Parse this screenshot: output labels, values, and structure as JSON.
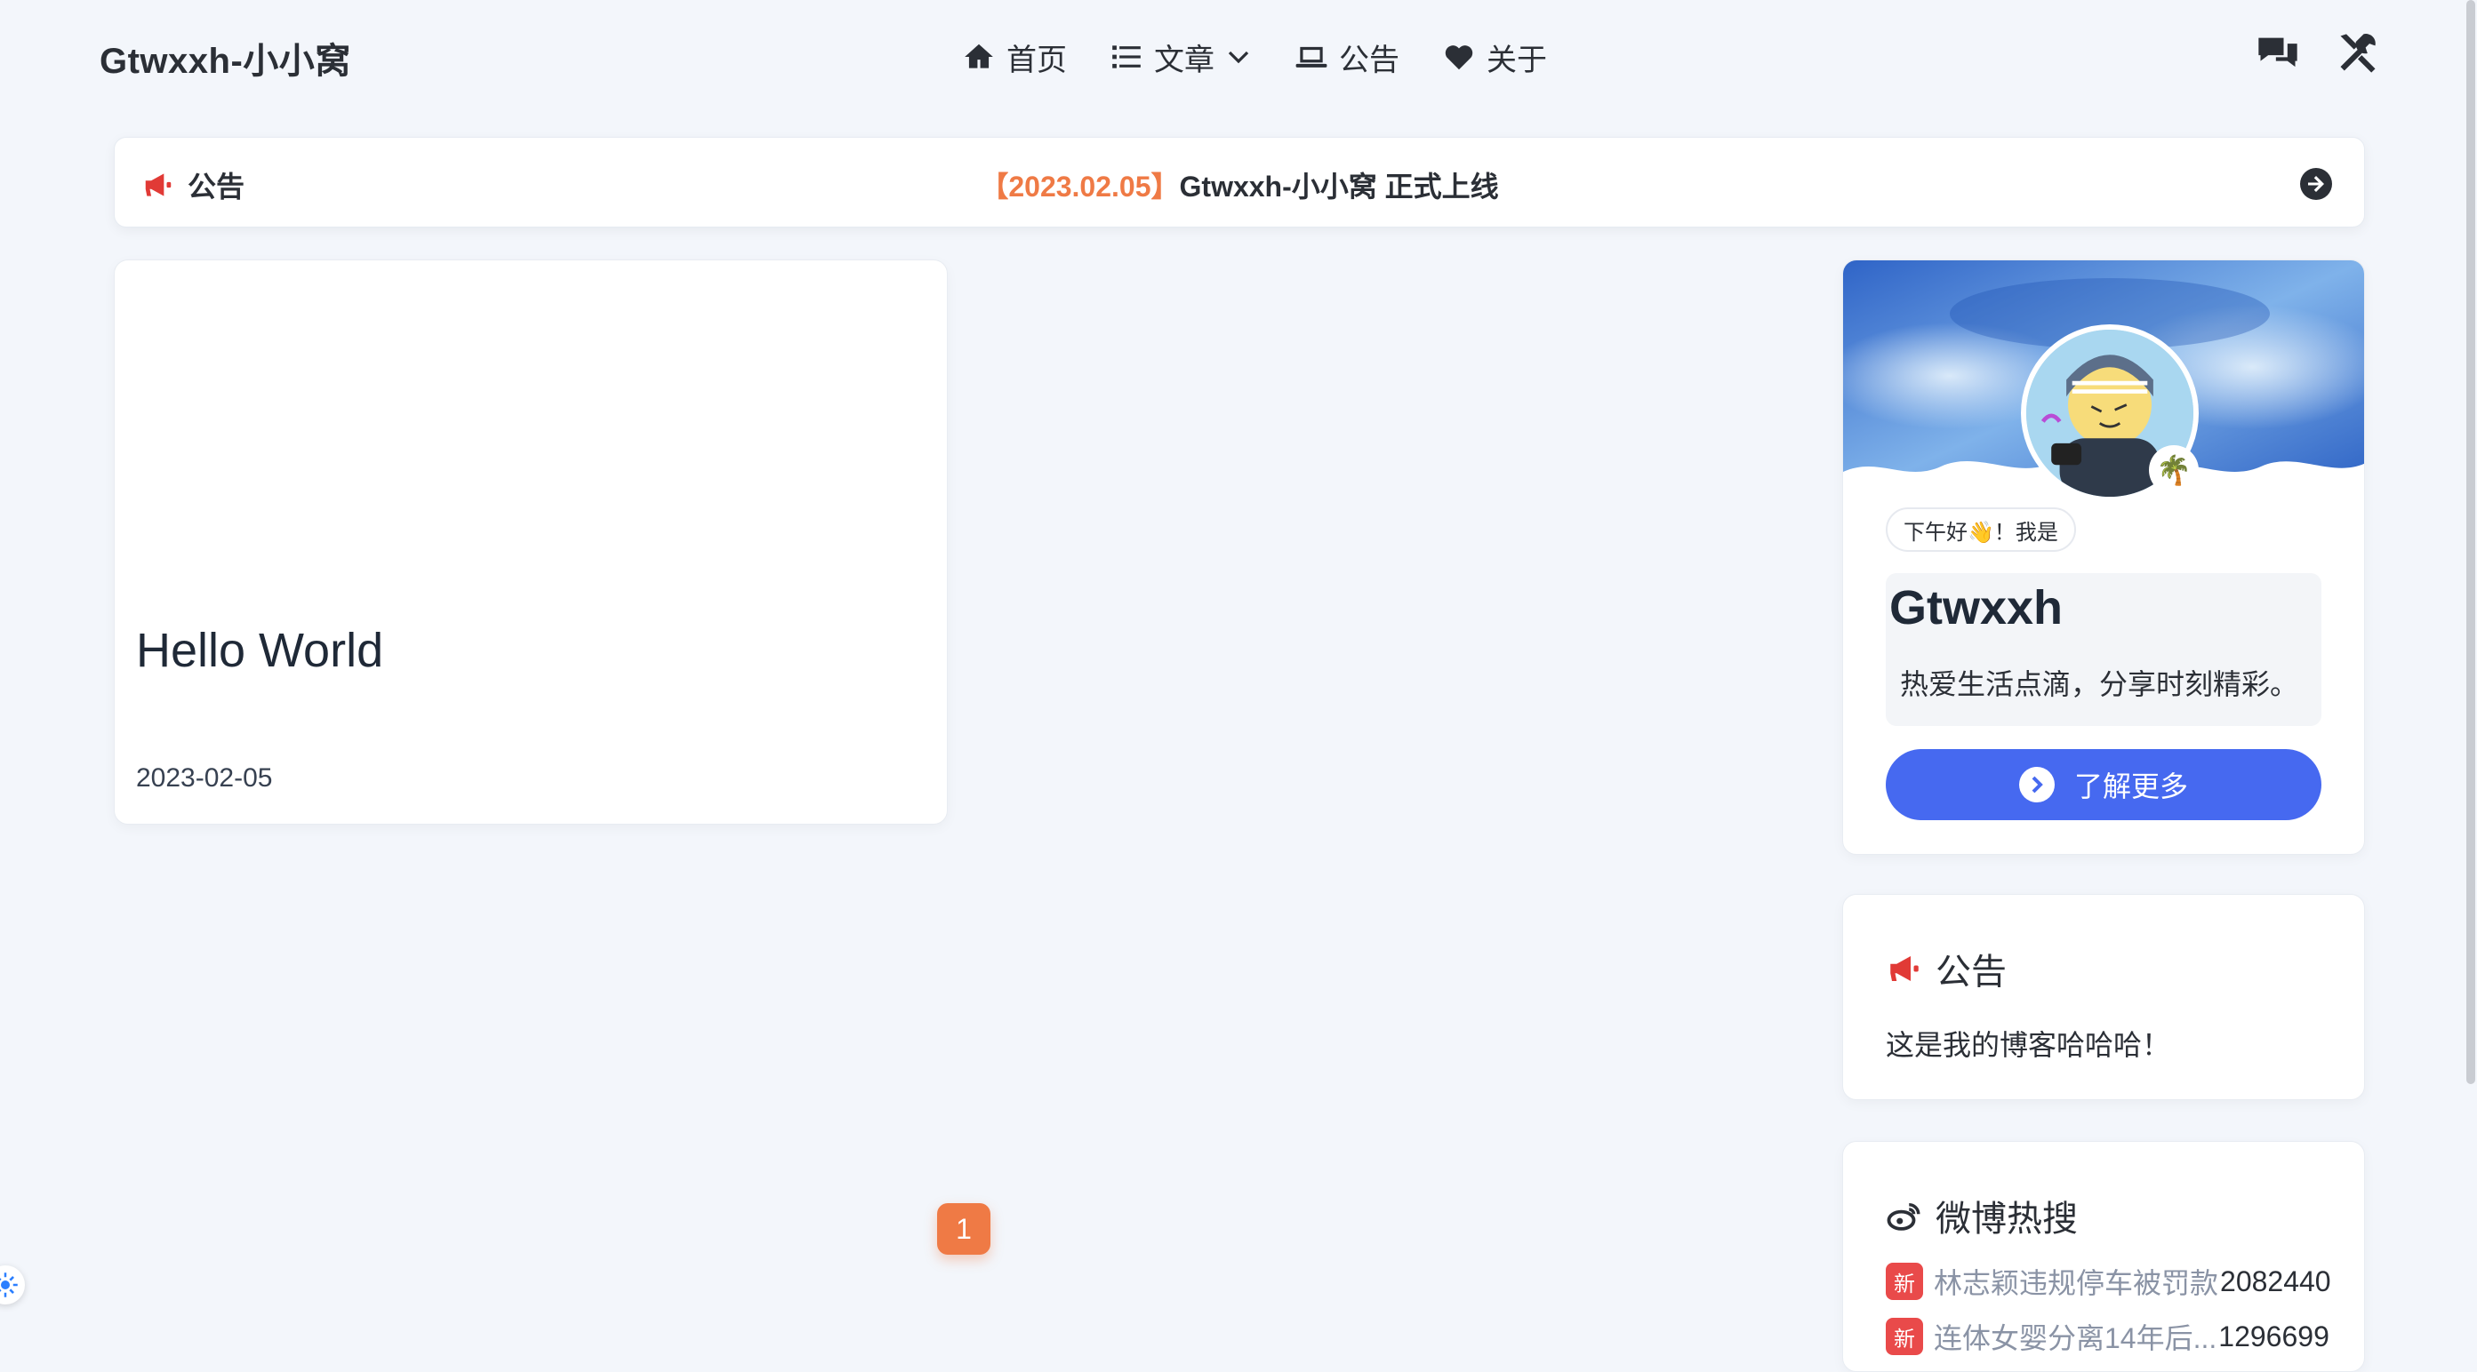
{
  "site": {
    "logo": "Gtwxxh-小小窝"
  },
  "nav": {
    "items": [
      {
        "label": "首页",
        "icon": "home-icon"
      },
      {
        "label": "文章",
        "icon": "list-icon"
      },
      {
        "label": "公告",
        "icon": "laptop-icon"
      },
      {
        "label": "关于",
        "icon": "heart-icon"
      }
    ],
    "right_icons": [
      "chat-icon",
      "tools-icon"
    ]
  },
  "announcement_bar": {
    "label": "公告",
    "date": "【2023.02.05】",
    "text": "Gtwxxh-小小窝 正式上线"
  },
  "post": {
    "title": "Hello World",
    "date": "2023-02-05"
  },
  "pagination": {
    "current": "1"
  },
  "profile": {
    "greeting": "下午好👋！我是",
    "name": "Gtwxxh",
    "bio": "热爱生活点滴，分享时刻精彩。",
    "button_label": "了解更多",
    "badge": "🌴"
  },
  "notice": {
    "title": "公告",
    "text": "这是我的博客哈哈哈！"
  },
  "weibo": {
    "title": "微博热搜",
    "items": [
      {
        "tag": "新",
        "title": "林志颖违规停车被罚款",
        "count": "2082440"
      },
      {
        "tag": "新",
        "title": "连体女婴分离14年后...",
        "count": "1296699"
      }
    ]
  },
  "colors": {
    "accent": "#ef7a45",
    "primary_button": "#4669f0",
    "notice_red": "#e13a36",
    "weibo_tag": "#e94a4a"
  }
}
